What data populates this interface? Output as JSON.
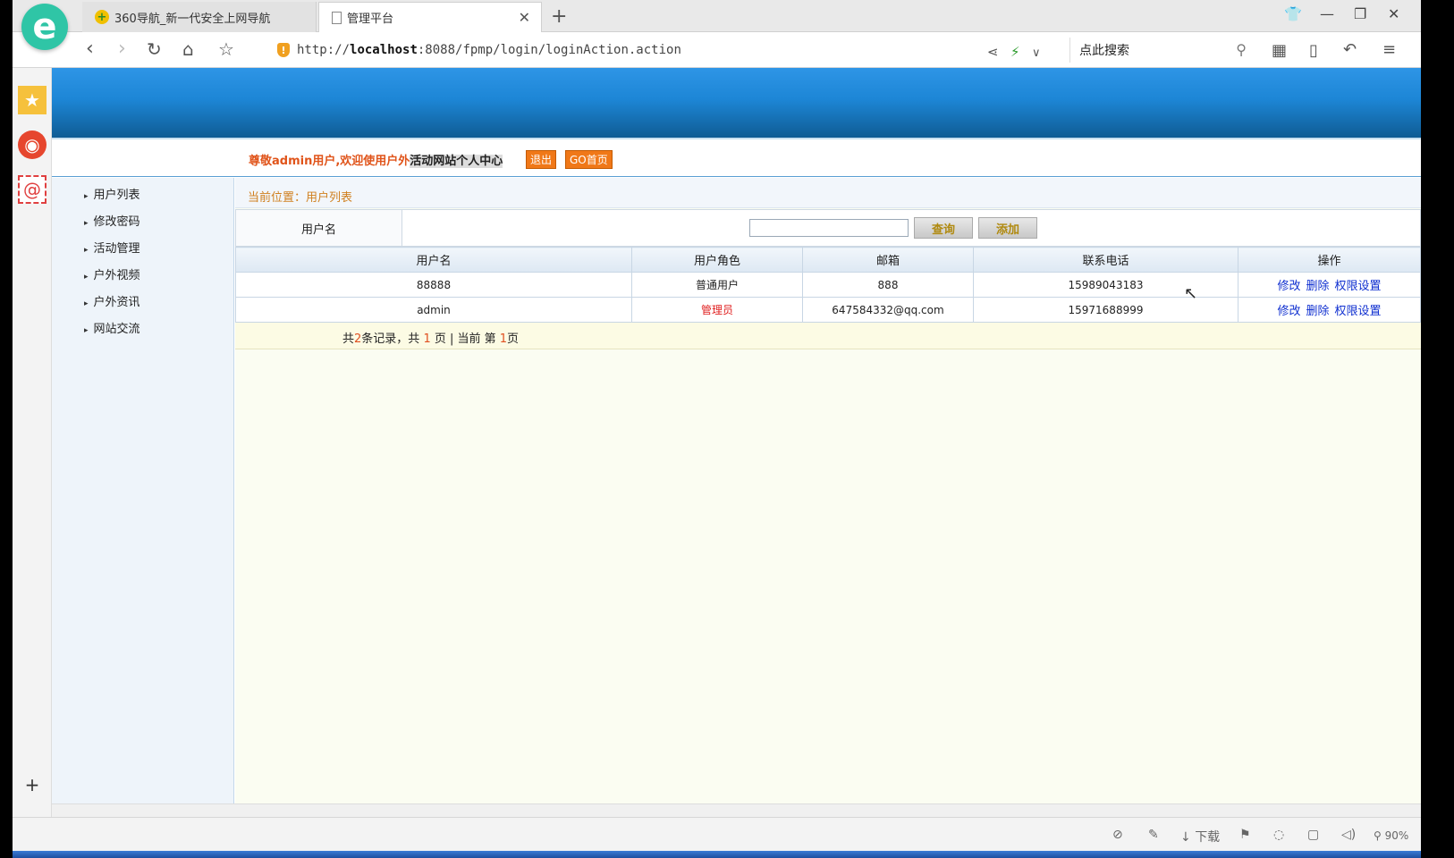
{
  "browser": {
    "logo_letter": "e",
    "tabs": [
      {
        "label": "360导航_新一代安全上网导航",
        "icon": "360-icon"
      },
      {
        "label": "管理平台",
        "icon": "page-icon"
      }
    ],
    "url_prefix": "http://",
    "url_host": "localhost",
    "url_rest": ":8088/fpmp/login/loginAction.action",
    "search_placeholder": "点此搜索",
    "download_label": "下载",
    "zoom": "90%"
  },
  "page": {
    "welcome_prefix": "尊敬admin用户,欢迎使用户外",
    "welcome_highlight": "活动网站个人中心",
    "logout_label": "退出",
    "home_label": "GO首页",
    "nav_items": [
      "用户列表",
      "修改密码",
      "活动管理",
      "户外视频",
      "户外资讯",
      "网站交流"
    ],
    "breadcrumb": "当前位置：用户列表",
    "filter": {
      "label": "用户名",
      "input_value": "",
      "query_label": "查询",
      "add_label": "添加"
    },
    "table": {
      "headers": [
        "用户名",
        "用户角色",
        "邮箱",
        "联系电话",
        "操作"
      ],
      "rows": [
        {
          "username": "88888",
          "role": "普通用户",
          "email": "888",
          "phone": "15989043183"
        },
        {
          "username": "admin",
          "role": "管理员",
          "email": "647584332@qq.com",
          "phone": "15971688999"
        }
      ],
      "actions": [
        "修改",
        "删除",
        "权限设置"
      ]
    },
    "pager": {
      "p1": "共",
      "total": "2",
      "p2": "条记录，共 ",
      "pages": "1",
      "p3": " 页 | 当前 第 ",
      "current": "1",
      "p4": "页"
    }
  }
}
